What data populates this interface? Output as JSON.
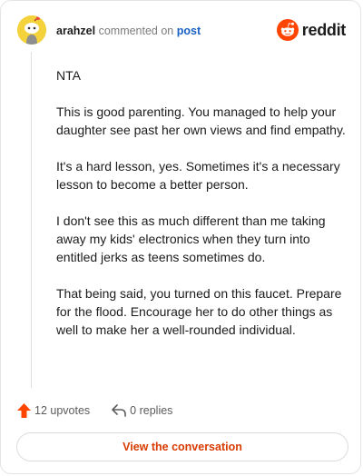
{
  "comment": {
    "author": "arahzel",
    "action_text": "commented on",
    "post_link": "post",
    "paragraphs": [
      "NTA",
      "This is good parenting. You managed to help your daughter see past her own views and find empathy.",
      "It's a hard lesson, yes. Sometimes it's a necessary lesson to become a better person.",
      "I don't see this as much different than me taking away my kids' electronics when they turn into entitled jerks as teens sometimes do.",
      "That being said, you turned on this faucet. Prepare for the flood. Encourage her to do other things as well to make her a well-rounded individual."
    ]
  },
  "brand": {
    "wordmark": "reddit",
    "icon": "reddit-snoo-icon",
    "color": "#ff4500"
  },
  "stats": {
    "upvotes_label": "12 upvotes",
    "replies_label": "0 replies",
    "upvote_icon": "upvote-arrow-icon",
    "reply_icon": "reply-arrow-icon",
    "upvote_color": "#ff4500"
  },
  "footer": {
    "view_label": "View the conversation",
    "color": "#d93a00"
  }
}
